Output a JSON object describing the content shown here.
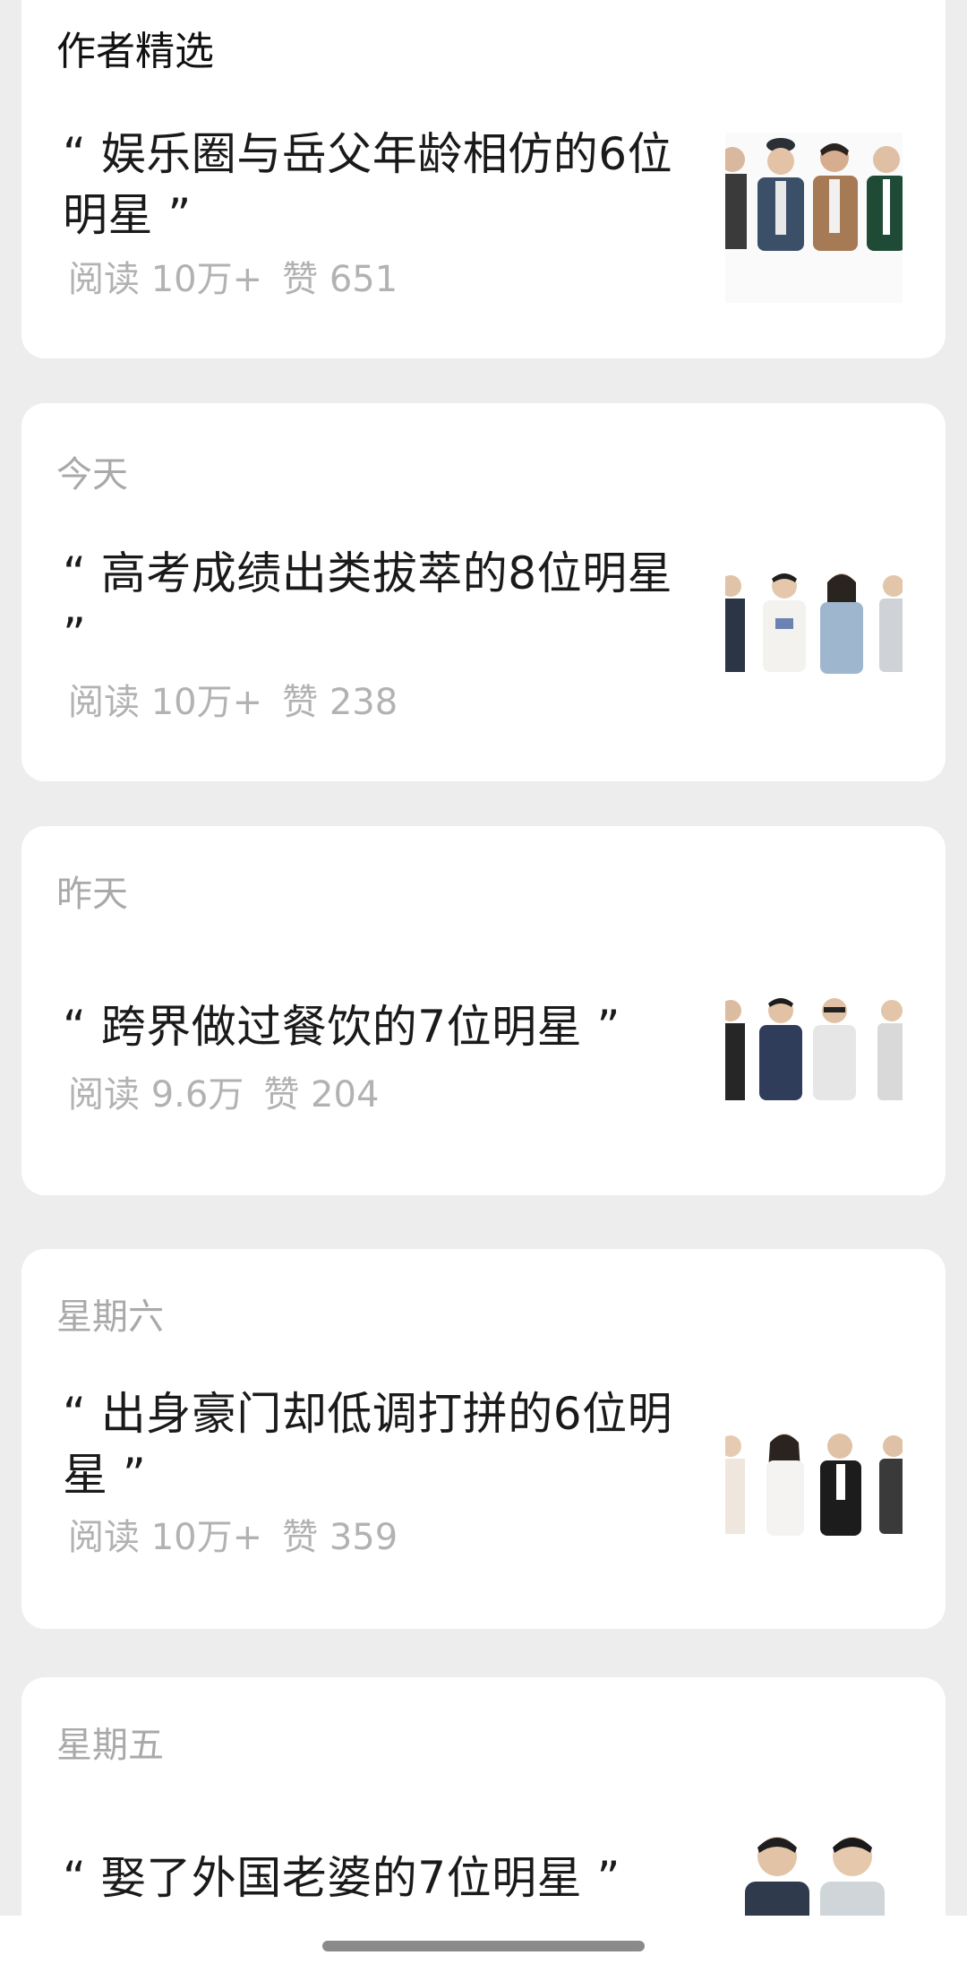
{
  "section": {
    "title": "作者精选"
  },
  "articles": [
    {
      "date": "",
      "title": "“ 娱乐圈与岳父年龄相仿的6位明星 ”",
      "reads": "阅读 10万+",
      "likes": "赞 651",
      "thumbnail": "illustrated-celebrities-thumbnail"
    },
    {
      "date": "今天",
      "title": "“ 高考成绩出类拔萃的8位明星 ”",
      "reads": "阅读 10万+",
      "likes": "赞 238",
      "thumbnail": "illustrated-celebrities-thumbnail"
    },
    {
      "date": "昨天",
      "title": "“ 跨界做过餐饮的7位明星 ”",
      "reads": "阅读 9.6万",
      "likes": "赞 204",
      "thumbnail": "illustrated-celebrities-thumbnail"
    },
    {
      "date": "星期六",
      "title": "“ 出身豪门却低调打拼的6位明星 ”",
      "reads": "阅读 10万+",
      "likes": "赞 359",
      "thumbnail": "illustrated-celebrities-thumbnail"
    },
    {
      "date": "星期五",
      "title": "“ 娶了外国老婆的7位明星 ”",
      "reads": "",
      "likes": "",
      "thumbnail": "illustrated-celebrities-thumbnail"
    }
  ],
  "colors": {
    "background": "#ededed",
    "card": "#ffffff",
    "title_text": "#1a1a1a",
    "muted_text": "#a9a9a9"
  }
}
